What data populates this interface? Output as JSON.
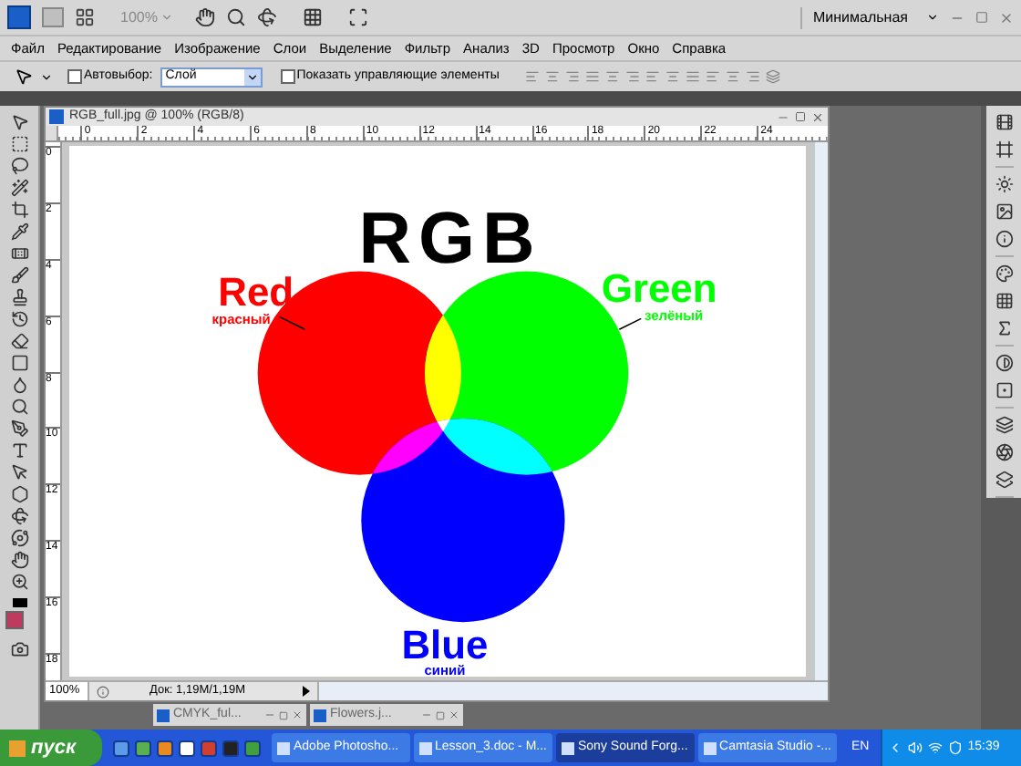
{
  "app_bar": {
    "zoom": "100%",
    "workspace": "Минимальная"
  },
  "menu": [
    "Файл",
    "Редактирование",
    "Изображение",
    "Слои",
    "Выделение",
    "Фильтр",
    "Анализ",
    "3D",
    "Просмотр",
    "Окно",
    "Справка"
  ],
  "options_bar": {
    "autoselect": {
      "label": "Автовыбор:",
      "checked": false
    },
    "layer_select": "Слой",
    "show_controls": {
      "label": "Показать управляющие элементы",
      "checked": false
    }
  },
  "document": {
    "title": "RGB_full.jpg @ 100% (RGB/8)",
    "ruler_h": [
      "0",
      "2",
      "4",
      "6",
      "8",
      "10",
      "12",
      "14",
      "16",
      "18",
      "20",
      "22",
      "24"
    ],
    "ruler_v": [
      "0",
      "2",
      "4",
      "6",
      "8",
      "10",
      "12",
      "14",
      "16",
      "18"
    ],
    "artwork": {
      "title": "RGB",
      "labels": [
        {
          "name": "Red",
          "sub": "красный",
          "color": "#ff0000"
        },
        {
          "name": "Green",
          "sub": "зелёный",
          "color": "#00ff00"
        },
        {
          "name": "Blue",
          "sub": "синий",
          "color": "#0000ff"
        }
      ]
    },
    "zoom": "100%",
    "doc_info": "Док: 1,19M/1,19M"
  },
  "minimized_docs": [
    "CMYK_ful...",
    "Flowers.j..."
  ],
  "taskbar": {
    "start": "пуск",
    "tasks": [
      {
        "label": "Adobe Photosho...",
        "selected": false
      },
      {
        "label": "Lesson_3.doc - M...",
        "selected": false
      },
      {
        "label": "Sony Sound Forg...",
        "selected": true
      },
      {
        "label": "Camtasia Studio -...",
        "selected": false
      }
    ],
    "lang": "EN",
    "clock": "15:39"
  }
}
